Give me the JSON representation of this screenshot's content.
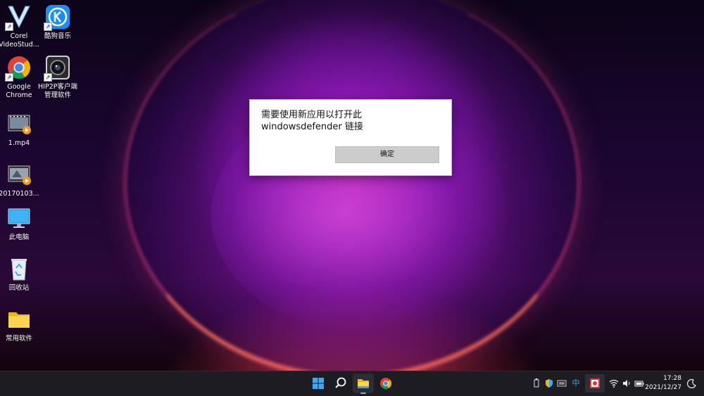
{
  "desktop_icons": [
    {
      "id": "corel",
      "label_line1": "Corel",
      "label_line2": "VideoStud...",
      "icon": "corel-videostudio-icon"
    },
    {
      "id": "kugou",
      "label_line1": "酷狗音乐",
      "label_line2": "",
      "icon": "kugou-music-icon"
    },
    {
      "id": "chrome",
      "label_line1": "Google",
      "label_line2": "Chrome",
      "icon": "chrome-icon"
    },
    {
      "id": "hip2p",
      "label_line1": "HIP2P客户端",
      "label_line2": "管理软件",
      "icon": "hip2p-camera-icon"
    },
    {
      "id": "mp4",
      "label_line1": "1.mp4",
      "label_line2": "",
      "icon": "video-file-icon"
    },
    {
      "id": "video2",
      "label_line1": "20170103...",
      "label_line2": "",
      "icon": "video-file-icon"
    },
    {
      "id": "thispc",
      "label_line1": "此电脑",
      "label_line2": "",
      "icon": "monitor-icon"
    },
    {
      "id": "recycle",
      "label_line1": "回收站",
      "label_line2": "",
      "icon": "recycle-bin-icon"
    },
    {
      "id": "folder",
      "label_line1": "常用软件",
      "label_line2": "",
      "icon": "folder-icon"
    }
  ],
  "dialog": {
    "message": "需要使用新应用以打开此 windowsdefender 链接",
    "ok_label": "确定"
  },
  "taskbar": {
    "apps": [
      "start-icon",
      "search-icon",
      "file-explorer-icon",
      "chrome-icon"
    ],
    "tray": {
      "ime_label": "中",
      "time": "17:28",
      "date": "2021/12/27"
    }
  },
  "colors": {
    "accent_blue": "#0a84ff",
    "taskbar_bg": "#1c1c22",
    "dialog_button": "#cccccc"
  }
}
